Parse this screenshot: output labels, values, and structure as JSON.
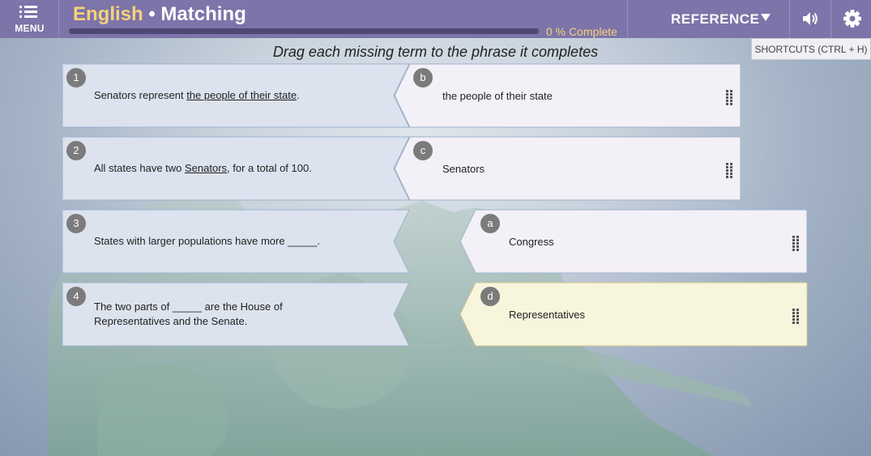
{
  "header": {
    "menu_label": "MENU",
    "subject": "English",
    "separator": " • ",
    "activity": "Matching",
    "progress_percent": 0,
    "progress_text": "0 % Complete",
    "reference_label": "REFERENCE",
    "shortcuts_tooltip": "SHORTCUTS (CTRL + H)"
  },
  "instruction": "Drag each missing term to the phrase it completes",
  "colors": {
    "topbar": "#7d74a9",
    "accent_gold": "#f5d37a",
    "phrase_fill": "#dce3ee",
    "term_fill": "#f3f0f7",
    "term_selected_fill": "#f8f5dd"
  },
  "phrases": [
    {
      "number": "1",
      "before": "Senators represent ",
      "answer": "the people of their state",
      "after": "."
    },
    {
      "number": "2",
      "before": "All states have two ",
      "answer": "Senators",
      "after": ", for a total of 100."
    },
    {
      "number": "3",
      "before": "States with larger populations have more _____.",
      "answer": "",
      "after": ""
    },
    {
      "number": "4",
      "before": "The two parts of _____ are the House of Representatives and the Senate.",
      "answer": "",
      "after": ""
    }
  ],
  "terms": [
    {
      "letter": "b",
      "text": "the people of their state",
      "matched_to": "1",
      "selected": false
    },
    {
      "letter": "c",
      "text": "Senators",
      "matched_to": "2",
      "selected": false
    },
    {
      "letter": "a",
      "text": "Congress",
      "matched_to": "",
      "selected": false
    },
    {
      "letter": "d",
      "text": "Representatives",
      "matched_to": "",
      "selected": true
    }
  ]
}
